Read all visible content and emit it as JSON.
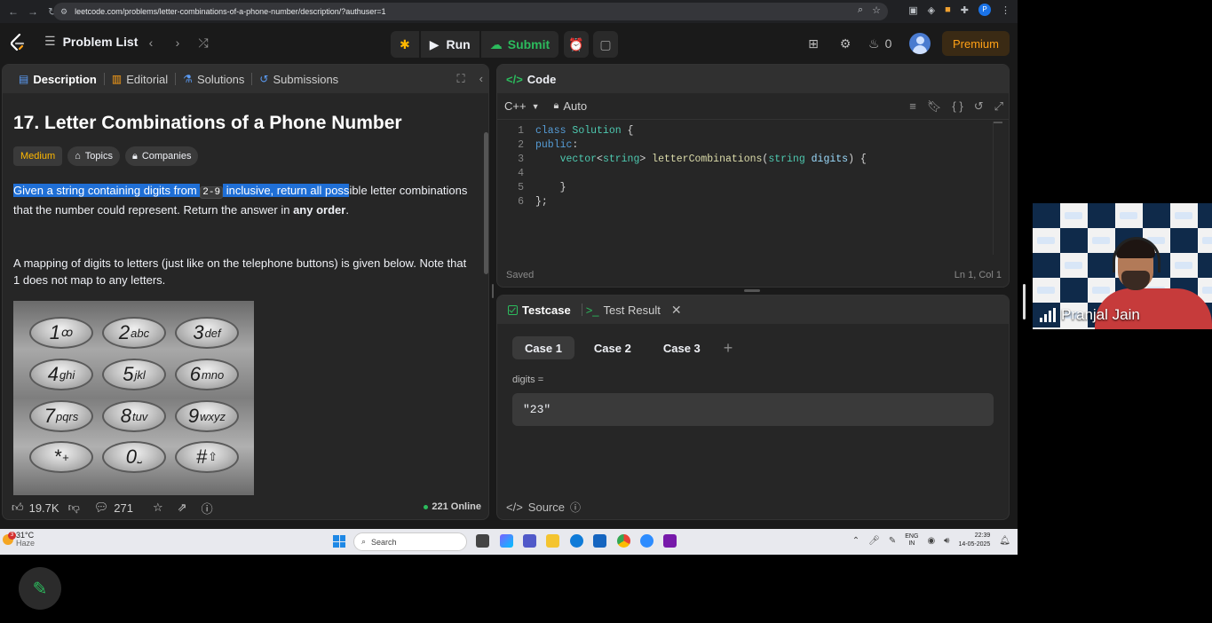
{
  "browser": {
    "url": "leetcode.com/problems/letter-combinations-of-a-phone-number/description/?authuser=1",
    "profile_initial": "P"
  },
  "nav": {
    "problem_list": "Problem List",
    "run": "Run",
    "submit": "Submit",
    "streak_count": "0",
    "premium": "Premium"
  },
  "left_tabs": [
    "Description",
    "Editorial",
    "Solutions",
    "Submissions"
  ],
  "problem": {
    "title": "17. Letter Combinations of a Phone Number",
    "difficulty": "Medium",
    "topics_tag": "Topics",
    "companies_tag": "Companies",
    "desc1_part1": "Given a string containing digits from ",
    "desc1_code": "2-9",
    "desc1_part2": " inclusive, return all poss",
    "desc1_part3": "ible letter combinations that the number could represent. Return the answer in ",
    "desc1_bold": "any order",
    "desc1_end": ".",
    "desc2": "A mapping of digits to letters (just like on the telephone buttons) is given below. Note that 1 does not map to any letters."
  },
  "keypad": {
    "keys": [
      {
        "num": "1",
        "letters": "ꝏ"
      },
      {
        "num": "2",
        "letters": "abc"
      },
      {
        "num": "3",
        "letters": "def"
      },
      {
        "num": "4",
        "letters": "ghi"
      },
      {
        "num": "5",
        "letters": "jkl"
      },
      {
        "num": "6",
        "letters": "mno"
      },
      {
        "num": "7",
        "letters": "pqrs"
      },
      {
        "num": "8",
        "letters": "tuv"
      },
      {
        "num": "9",
        "letters": "wxyz"
      },
      {
        "num": "*",
        "letters": "+"
      },
      {
        "num": "0",
        "letters": "⎵"
      },
      {
        "num": "#",
        "letters": "⇧"
      }
    ]
  },
  "left_footer": {
    "likes": "19.7K",
    "comments": "271",
    "online": "221 Online"
  },
  "code": {
    "header": "Code",
    "language": "C++",
    "auto": "Auto",
    "saved": "Saved",
    "cursor": "Ln 1, Col 1",
    "lines": [
      {
        "n": "1"
      },
      {
        "n": "2"
      },
      {
        "n": "3"
      },
      {
        "n": "4"
      },
      {
        "n": "5"
      },
      {
        "n": "6"
      }
    ]
  },
  "tests": {
    "tab_testcase": "Testcase",
    "tab_result": "Test Result",
    "cases": [
      "Case 1",
      "Case 2",
      "Case 3"
    ],
    "param_label": "digits =",
    "param_value": "\"23\"",
    "source": "Source"
  },
  "taskbar": {
    "temp": "31°C",
    "weather": "Haze",
    "weather_badge": "3",
    "search": "Search",
    "lang_top": "ENG",
    "lang_bottom": "IN",
    "time": "22:39",
    "date": "14-05-2025"
  },
  "webcam": {
    "name": "Pranjal Jain"
  },
  "colors": {
    "accent_green": "#2cbb5d",
    "medium_yellow": "#ffb800",
    "premium_orange": "#ffa116",
    "selection_blue": "#1f6fd6"
  }
}
